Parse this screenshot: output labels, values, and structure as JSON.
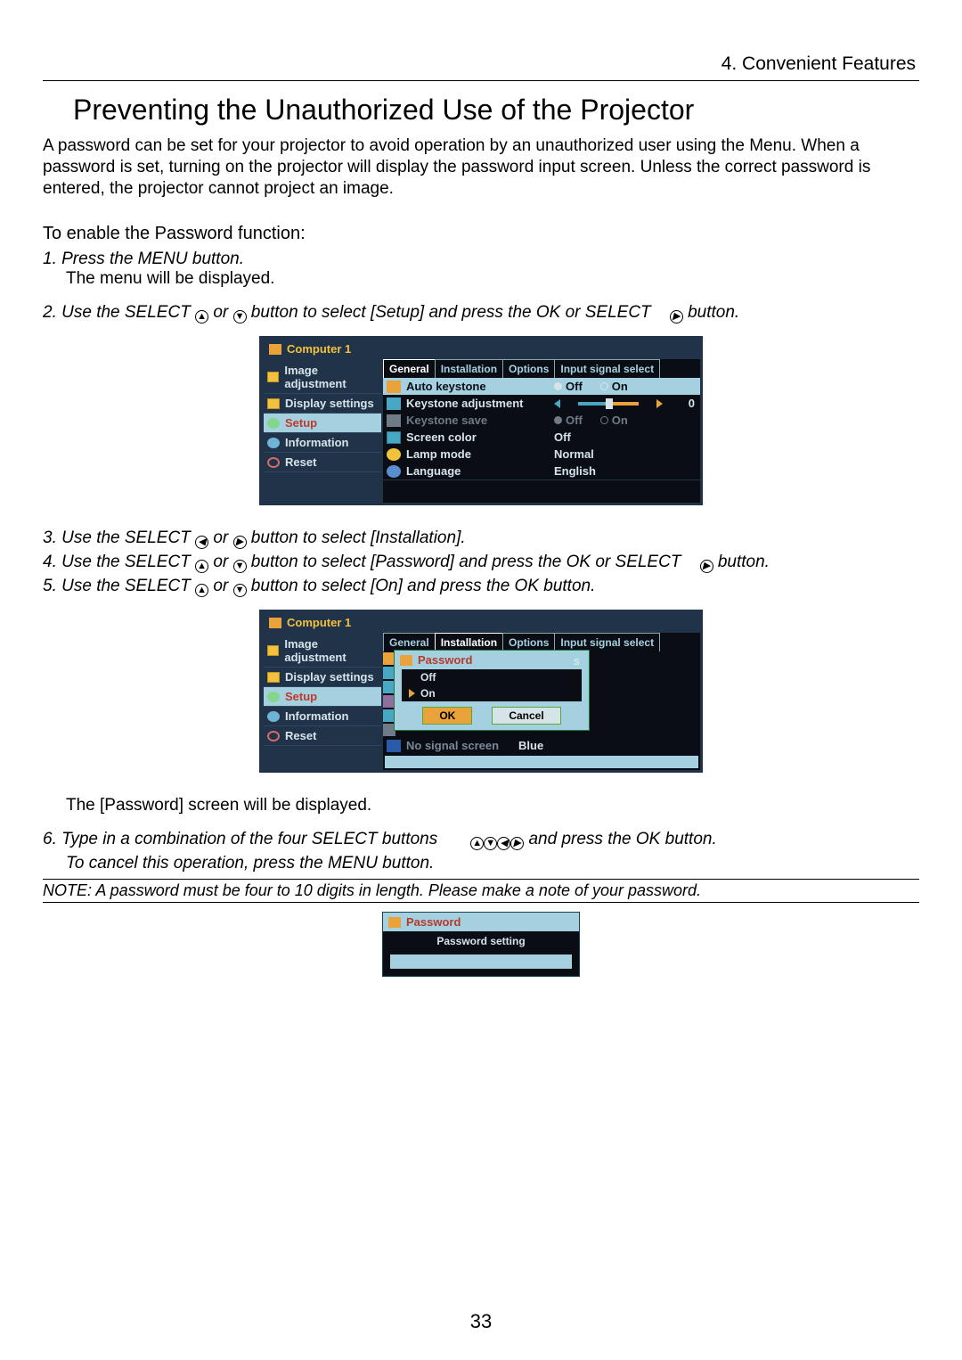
{
  "breadcrumb": "4. Convenient Features",
  "heading": "Preventing the Unauthorized Use of the Projector",
  "intro": "A password can be set for your projector to avoid operation by an unauthorized user using the Menu. When a password is set, turning on the projector will display the password input screen. Unless the correct password is entered, the projector cannot project an image.",
  "enable_heading": "To  enable the Password function:",
  "step1": "1.  Press the MENU button.",
  "step1_sub": "The menu will be displayed.",
  "step2_a": "2.  Use the SELECT ",
  "step2_b": " or ",
  "step2_c": " button to select [Setup] and press the OK or SELECT ",
  "step2_d": " button.",
  "step3_a": "3.  Use the SELECT ",
  "step3_b": " or ",
  "step3_c": " button to select [Installation].",
  "step4_a": "4.  Use the SELECT ",
  "step4_b": " or ",
  "step4_c": " button to select  [Password] and press the OK or SELECT ",
  "step4_d": " button.",
  "step5_a": "5.  Use the SELECT ",
  "step5_b": " or ",
  "step5_c": " button to select [On] and press the OK button.",
  "pw_screen_text": "The [Password] screen will be displayed.",
  "step6_a": "6.  Type in a combination of the four SELECT buttons ",
  "step6_b": " and press the OK button.",
  "step6_sub": "To cancel this operation, press the MENU button.",
  "note": "NOTE: A password must be four to 10  digits in length. Please make a note of your password.",
  "page_number": "33",
  "osd": {
    "title": "Computer 1",
    "side": {
      "image": "Image adjustment",
      "display": "Display settings",
      "setup": "Setup",
      "info": "Information",
      "reset": "Reset"
    },
    "tabs": {
      "general": "General",
      "installation": "Installation",
      "options": "Options",
      "input": "Input signal select"
    },
    "setup_rows": {
      "auto_keystone": "Auto keystone",
      "keystone_adj": "Keystone adjustment",
      "keystone_save": "Keystone save",
      "screen_color": "Screen color",
      "lamp_mode": "Lamp mode",
      "language": "Language",
      "off": "Off",
      "on": "On",
      "normal": "Normal",
      "english": "English",
      "slider_val": "0"
    },
    "password_popup": {
      "title": "Password",
      "off": "Off",
      "on": "On",
      "ok": "OK",
      "cancel": "Cancel",
      "s": "s"
    },
    "install_rows": {
      "nosignal": "No signal screen",
      "blue": "Blue"
    },
    "pw_dialog": {
      "title": "Password",
      "setting": "Password setting"
    }
  }
}
